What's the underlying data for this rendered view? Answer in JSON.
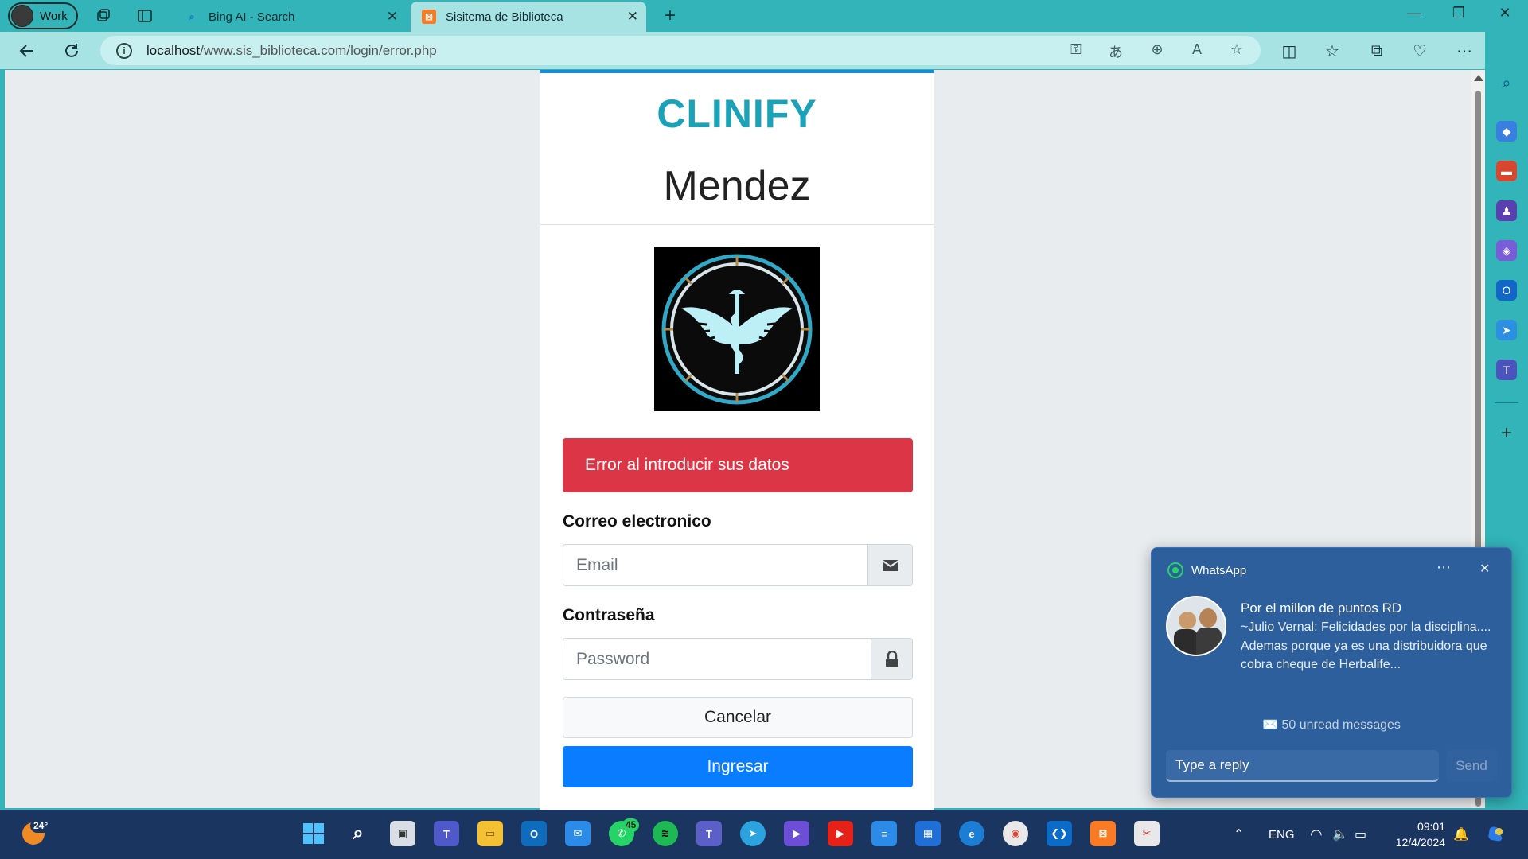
{
  "browser": {
    "profile_label": "Work",
    "tabs": [
      {
        "title": "Bing AI - Search",
        "active": false
      },
      {
        "title": "Sisitema de Biblioteca",
        "active": true
      }
    ],
    "url_host": "localhost",
    "url_path": "/www.sis_biblioteca.com/login/error.php"
  },
  "login": {
    "brand": "CLINIFY",
    "subtitle": "Mendez",
    "error_message": "Error al introducir sus datos",
    "email_label": "Correo electronico",
    "email_placeholder": "Email",
    "password_label": "Contraseña",
    "password_placeholder": "Password",
    "cancel_label": "Cancelar",
    "submit_label": "Ingresar"
  },
  "notification": {
    "app": "WhatsApp",
    "title": "Por el millon de puntos RD",
    "body": "~Julio Vernal: Felicidades por la disciplina.... Ademas porque ya es una distribuidora que cobra cheque de Herbalife...",
    "unread": "✉️ 50 unread messages",
    "reply_placeholder": "Type a reply",
    "send_label": "Send"
  },
  "taskbar": {
    "weather": "24°",
    "whatsapp_badge": "45",
    "lang": "ENG",
    "time": "09:01",
    "date": "12/4/2024"
  },
  "colors": {
    "accent": "#32b4b8",
    "brand": "#1aa3b8",
    "danger": "#dc3545",
    "primary": "#0a7cff"
  }
}
